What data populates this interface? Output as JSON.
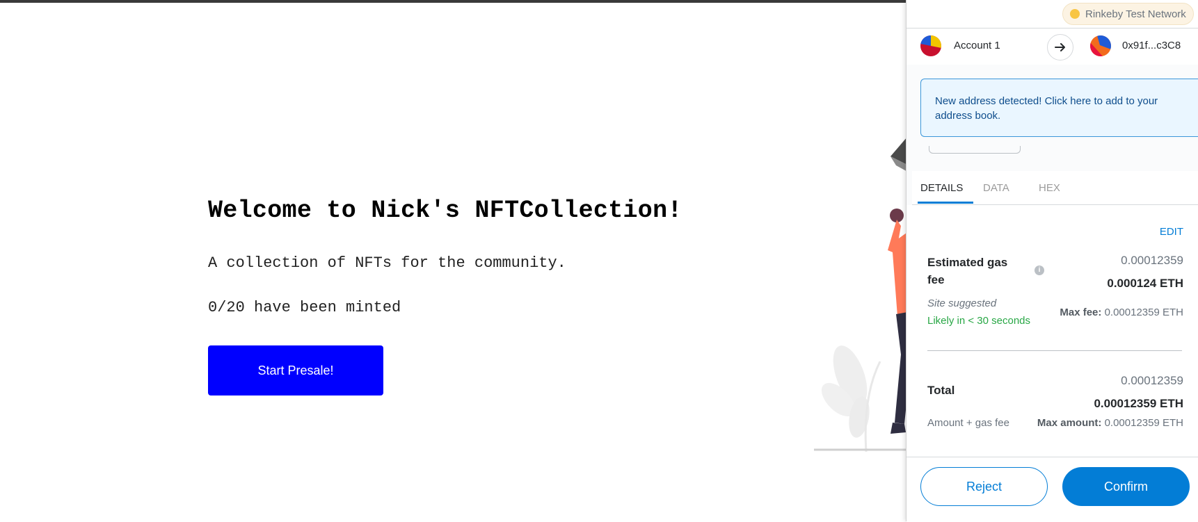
{
  "dapp": {
    "title": "Welcome to Nick's NFTCollection!",
    "description": "A collection of NFTs for the community.",
    "minted_status": "0/20 have been minted",
    "presale_button": "Start Presale!"
  },
  "metamask": {
    "network": "Rinkeby Test Network",
    "from_account": "Account 1",
    "to_address": "0x91f...c3C8",
    "new_address_banner": "New address detected! Click here to add to your address book.",
    "tabs": [
      "DETAILS",
      "DATA",
      "HEX"
    ],
    "active_tab": "DETAILS",
    "edit_label": "EDIT",
    "gas": {
      "label": "Estimated gas fee",
      "secondary_value": "0.00012359",
      "primary_value": "0.000124 ETH",
      "site_suggested": "Site suggested",
      "likely": "Likely in < 30 seconds",
      "max_fee_label": "Max fee:",
      "max_fee_value": "0.00012359 ETH"
    },
    "total": {
      "label": "Total",
      "secondary_value": "0.00012359",
      "primary_value": "0.00012359 ETH",
      "sub_label": "Amount + gas fee",
      "max_amount_label": "Max amount:",
      "max_amount_value": "0.00012359 ETH"
    },
    "reject_label": "Reject",
    "confirm_label": "Confirm"
  },
  "colors": {
    "presale_button": "#0000ff",
    "metamask_primary": "#037dd6",
    "likely_text": "#28a745",
    "network_dot": "#f8c543"
  },
  "icons": {
    "info": "info-icon",
    "arrow": "arrow-right-icon"
  }
}
